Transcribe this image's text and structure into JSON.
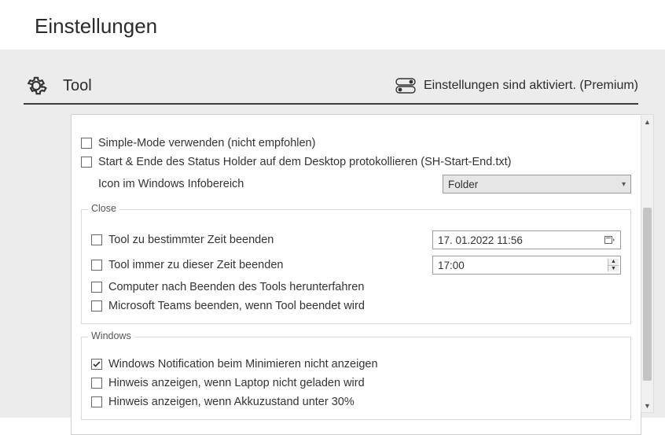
{
  "title": "Einstellungen",
  "section": {
    "name": "Tool",
    "status": "Einstellungen sind aktiviert. (Premium)"
  },
  "top": {
    "simple_mode": "Simple-Mode verwenden (nicht empfohlen)",
    "protocol": "Start & Ende des Status Holder auf dem Desktop protokollieren (SH-Start-End.txt)",
    "icon_label": "Icon im Windows Infobereich",
    "icon_value": "Folder"
  },
  "close": {
    "legend": "Close",
    "end_at_time": "Tool zu bestimmter Zeit beenden",
    "end_at_time_value": "17. 01.2022   11:56",
    "always_end": "Tool immer zu dieser Zeit beenden",
    "always_end_value": "17:00",
    "shutdown": "Computer nach Beenden des Tools herunterfahren",
    "teams": "Microsoft Teams beenden, wenn Tool beendet wird"
  },
  "windows": {
    "legend": "Windows",
    "no_notify": "Windows Notification beim Minimieren nicht anzeigen",
    "laptop": "Hinweis anzeigen, wenn Laptop nicht geladen wird",
    "battery": "Hinweis anzeigen, wenn Akkuzustand unter 30%"
  }
}
